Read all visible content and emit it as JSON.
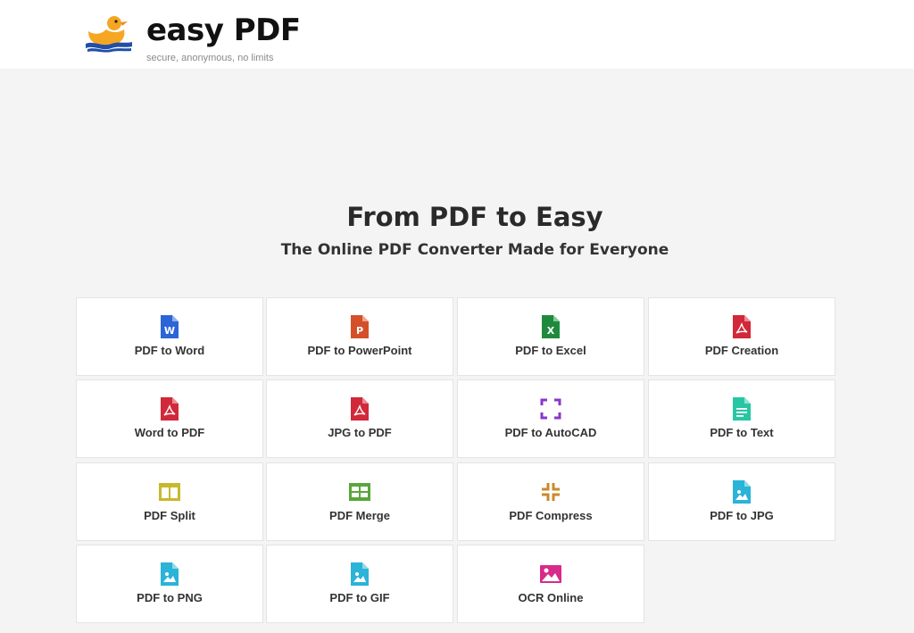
{
  "brand": {
    "name": "easy PDF",
    "tagline": "secure, anonymous, no limits"
  },
  "hero": {
    "title": "From PDF to Easy",
    "subtitle": "The Online PDF Converter Made for Everyone"
  },
  "colors": {
    "word": "#2b65d6",
    "powerpoint": "#d4502a",
    "excel": "#1f8a3e",
    "pdf": "#d1283a",
    "autocad": "#8a36c9",
    "text": "#28c6a3",
    "split": "#c9b82c",
    "merge": "#5aa63a",
    "compress": "#c98a2c",
    "image": "#2bb3d8",
    "ocr": "#d82a8a"
  },
  "tools": [
    {
      "label": "PDF to Word",
      "icon": "word-file-icon"
    },
    {
      "label": "PDF to PowerPoint",
      "icon": "powerpoint-file-icon"
    },
    {
      "label": "PDF to Excel",
      "icon": "excel-file-icon"
    },
    {
      "label": "PDF Creation",
      "icon": "pdf-file-icon"
    },
    {
      "label": "Word to PDF",
      "icon": "pdf-file-icon"
    },
    {
      "label": "JPG to PDF",
      "icon": "pdf-file-icon"
    },
    {
      "label": "PDF to AutoCAD",
      "icon": "autocad-frame-icon"
    },
    {
      "label": "PDF to Text",
      "icon": "text-file-icon"
    },
    {
      "label": "PDF Split",
      "icon": "split-columns-icon"
    },
    {
      "label": "PDF Merge",
      "icon": "merge-grid-icon"
    },
    {
      "label": "PDF Compress",
      "icon": "compress-arrows-icon"
    },
    {
      "label": "PDF to JPG",
      "icon": "image-file-icon"
    },
    {
      "label": "PDF to PNG",
      "icon": "image-file-icon"
    },
    {
      "label": "PDF to GIF",
      "icon": "image-file-icon"
    },
    {
      "label": "OCR Online",
      "icon": "photo-icon"
    }
  ]
}
